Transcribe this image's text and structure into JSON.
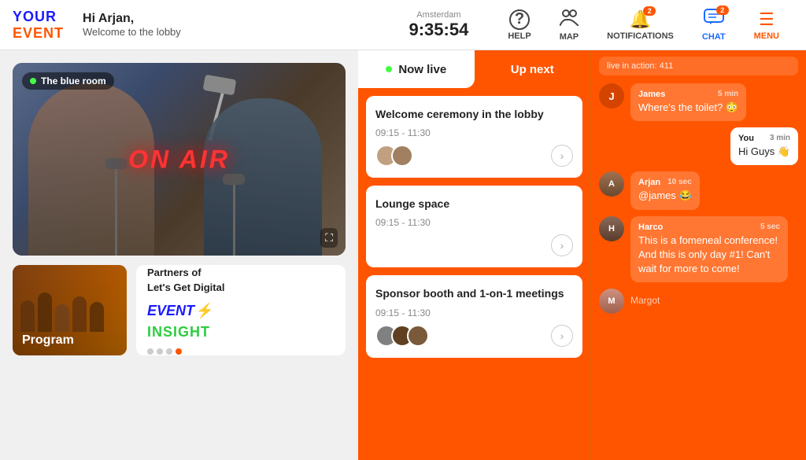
{
  "header": {
    "logo_your": "YOUR",
    "logo_event": "EVENT",
    "greeting_hi": "Hi Arjan,",
    "greeting_sub": "Welcome to the lobby",
    "clock_city": "Amsterdam",
    "clock_time": "9:35:54",
    "nav": [
      {
        "id": "help",
        "icon": "?",
        "label": "HELP",
        "badge": null
      },
      {
        "id": "map",
        "icon": "👥",
        "label": "MAP",
        "badge": null
      },
      {
        "id": "notifications",
        "icon": "🔔",
        "label": "NOTIFICATIONS",
        "badge": "2"
      },
      {
        "id": "chat",
        "icon": "💬",
        "label": "CHAT",
        "badge": "2"
      },
      {
        "id": "menu",
        "icon": "☰",
        "label": "MENU",
        "badge": null
      }
    ]
  },
  "video_card": {
    "room_label": "The blue room",
    "on_air": "ON AIR"
  },
  "program_card": {
    "label": "Program"
  },
  "partner_card": {
    "title": "Partners of\nLet's Get Digital",
    "logo_event": "EVENT",
    "logo_icon": "⚡",
    "logo_insight": "INSIGHT"
  },
  "tabs": {
    "now_live": "Now live",
    "up_next": "Up next"
  },
  "sessions": [
    {
      "title": "Welcome ceremony in the lobby",
      "time": "09:15 - 11:30",
      "avatars": 2
    },
    {
      "title": "Lounge space",
      "time": "09:15 - 11:30",
      "avatars": 0
    },
    {
      "title": "Sponsor booth and 1-on-1 meetings",
      "time": "09:15 - 11:30",
      "avatars": 3
    }
  ],
  "chat": {
    "header": "live in action: 411",
    "messages": [
      {
        "sender": "S",
        "name": null,
        "text": "live in action: 411",
        "time": null,
        "style": "top"
      },
      {
        "sender": "J",
        "name": "James",
        "text": "Where's the toilet? 😳",
        "time": "5 min",
        "style": "normal"
      },
      {
        "sender": "Y",
        "name": "You",
        "text": "Hi Guys 👋",
        "time": "3 min",
        "style": "white"
      },
      {
        "sender": "A",
        "name": "Arjan",
        "text": "@james 😂",
        "time": "10 sec",
        "style": "normal",
        "has_avatar_img": true
      },
      {
        "sender": "H",
        "name": "Harco",
        "text": "This is a fomeneal conference! And this is only day #1! Can't wait for more to come!",
        "time": "5 sec",
        "style": "normal",
        "has_avatar_img": true
      },
      {
        "sender": "M",
        "name": "Margot",
        "text": "",
        "time": null,
        "style": "normal"
      }
    ]
  }
}
